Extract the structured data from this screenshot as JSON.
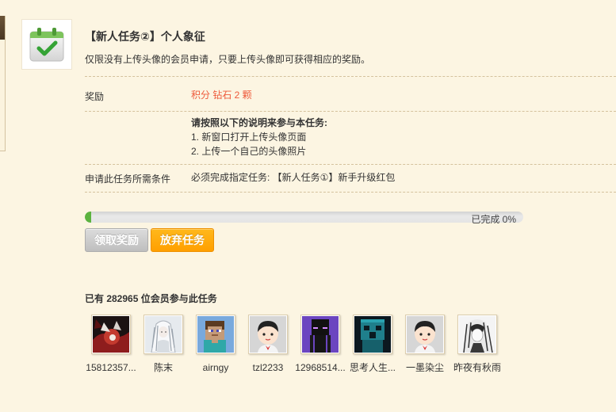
{
  "task": {
    "icon": "calendar-check-icon",
    "title": "【新人任务②】个人象征",
    "description": "仅限没有上传头像的会员申请，只要上传头像即可获得相应的奖励。"
  },
  "reward": {
    "label": "奖励",
    "value": "积分 钻石 2 颗"
  },
  "instructions": {
    "heading": "请按照以下的说明来参与本任务:",
    "steps": [
      "1. 新窗口打开上传头像页面",
      "2. 上传一个自己的头像照片"
    ]
  },
  "requirement": {
    "label": "申请此任务所需条件",
    "value": "必须完成指定任务: 【新人任务①】新手升级红包"
  },
  "progress": {
    "percent": 0,
    "label": "已完成 0%"
  },
  "actions": {
    "claim_label": "领取奖励",
    "abandon_label": "放弃任务"
  },
  "participants": {
    "summary": "已有 282965 位会员参与此任务",
    "members": [
      {
        "name": "15812357..."
      },
      {
        "name": "陈末"
      },
      {
        "name": "airngy"
      },
      {
        "name": "tzl2233"
      },
      {
        "name": "12968514..."
      },
      {
        "name": "思考人生..."
      },
      {
        "name": "一墨染尘"
      },
      {
        "name": "昨夜有秋雨"
      }
    ]
  },
  "colors": {
    "page_background": "#FCF5E2",
    "reward_text": "#EE5A3B",
    "abandon_button": "#FF9F00",
    "progress_fill": "#5CB33F"
  }
}
